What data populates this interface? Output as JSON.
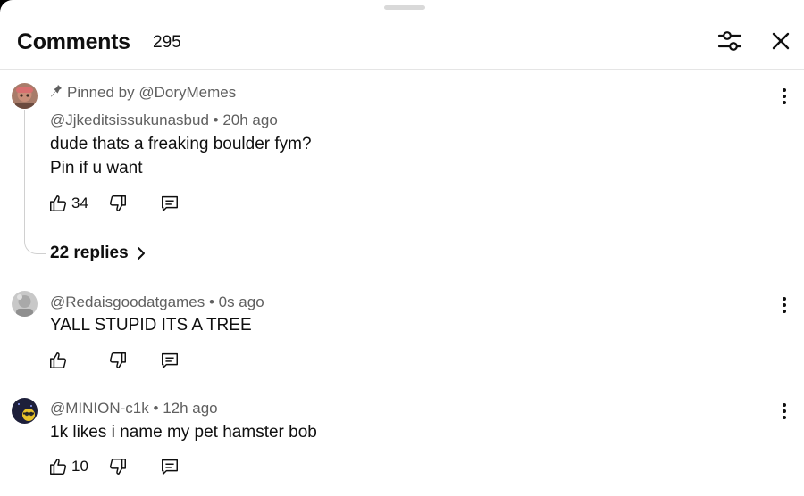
{
  "header": {
    "title": "Comments",
    "count": "295"
  },
  "comments": [
    {
      "pinned_label": "Pinned by @DoryMemes",
      "author": "@Jjkeditsissukunasbud",
      "time": "20h ago",
      "lines": [
        "dude thats a freaking boulder fym?",
        "Pin if u want"
      ],
      "likes": "34",
      "replies_label": "22 replies"
    },
    {
      "author": "@Redaisgoodatgames",
      "time": "0s ago",
      "lines": [
        "YALL STUPID ITS A TREE"
      ],
      "likes": ""
    },
    {
      "author": "@MINION-c1k",
      "time": "12h ago",
      "lines": [
        "1k likes i name my pet hamster bob"
      ],
      "likes": "10"
    }
  ],
  "separator": "•",
  "icons": [
    "filter-sliders-icon",
    "close-icon",
    "pin-icon",
    "thumb-up-icon",
    "thumb-down-icon",
    "reply-icon",
    "more-vertical-icon",
    "chevron-right-icon"
  ]
}
